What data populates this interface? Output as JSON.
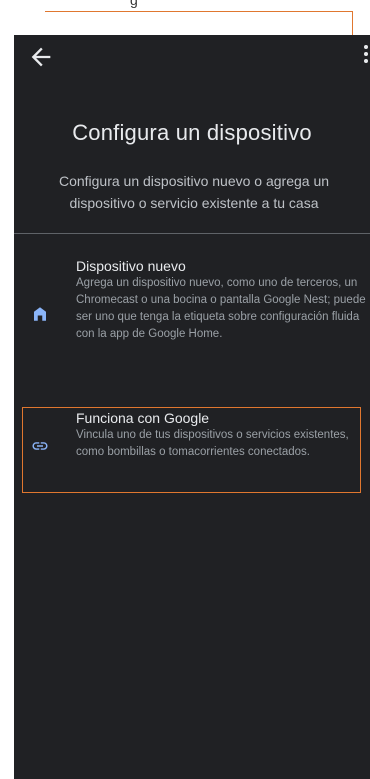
{
  "annotation": {
    "caption": "g"
  },
  "header": {
    "title": "Configura un dispositivo",
    "subtitle": "Configura un dispositivo nuevo o agrega un dispositivo o servicio existente a tu casa"
  },
  "options": [
    {
      "label": "Dispositivo nuevo",
      "description": "Agrega un dispositivo nuevo, como uno de terceros, un Chromecast o una bocina o pantalla Google Nest; puede ser uno que tenga la etiqueta sobre configuración fluida con la app de Google Home.",
      "icon": "home-icon"
    },
    {
      "label": "Funciona con Google",
      "description": "Vincula uno de tus dispositivos o servicios existentes, como bombillas o tomacorrientes conectados.",
      "icon": "link-icon"
    }
  ],
  "colors": {
    "background": "#202124",
    "accent": "#8ab4f8",
    "annotation": "#e0772f"
  }
}
